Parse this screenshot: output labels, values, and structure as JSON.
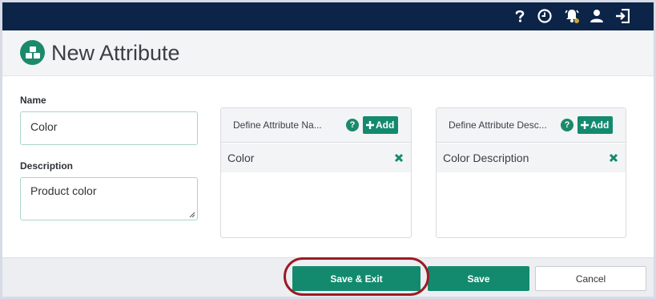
{
  "topbar": {
    "icons": [
      "help-icon",
      "clock-icon",
      "notifications-icon",
      "user-icon",
      "logout-icon"
    ],
    "accent": "#0b2447"
  },
  "header": {
    "title": "New Attribute",
    "logo_icon": "cubes-icon"
  },
  "form": {
    "name_label": "Name",
    "name_value": "Color",
    "description_label": "Description",
    "description_value": "Product color"
  },
  "panels": [
    {
      "title": "Define Attribute Na...",
      "add_label": "Add",
      "items": [
        {
          "label": "Color"
        }
      ]
    },
    {
      "title": "Define Attribute Desc...",
      "add_label": "Add",
      "items": [
        {
          "label": "Color Description"
        }
      ]
    }
  ],
  "footer": {
    "save_exit_label": "Save & Exit",
    "save_label": "Save",
    "cancel_label": "Cancel"
  },
  "colors": {
    "primary": "#138a6e",
    "highlight": "#9b1b24"
  }
}
